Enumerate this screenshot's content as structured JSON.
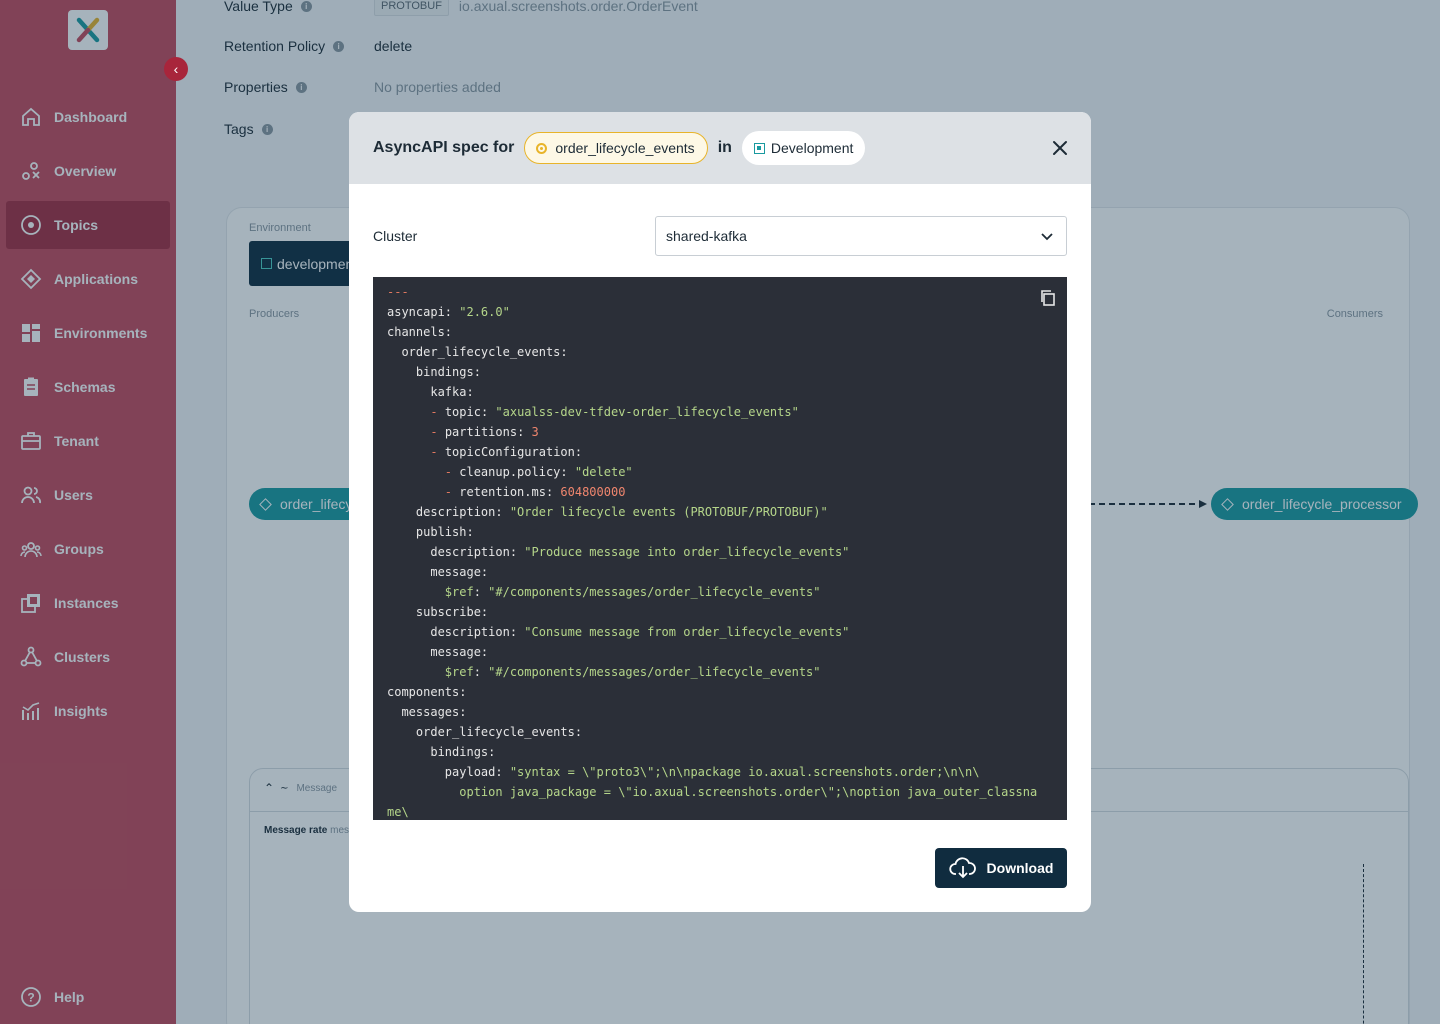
{
  "sidebar": {
    "items": [
      {
        "label": "Dashboard",
        "icon": "home-icon"
      },
      {
        "label": "Overview",
        "icon": "overview-icon"
      },
      {
        "label": "Topics",
        "icon": "topic-icon",
        "active": true
      },
      {
        "label": "Applications",
        "icon": "application-icon"
      },
      {
        "label": "Environments",
        "icon": "environment-icon"
      },
      {
        "label": "Schemas",
        "icon": "schema-icon"
      },
      {
        "label": "Tenant",
        "icon": "tenant-icon"
      },
      {
        "label": "Users",
        "icon": "users-icon"
      },
      {
        "label": "Groups",
        "icon": "groups-icon"
      },
      {
        "label": "Instances",
        "icon": "instances-icon"
      },
      {
        "label": "Clusters",
        "icon": "clusters-icon"
      },
      {
        "label": "Insights",
        "icon": "insights-icon"
      }
    ],
    "help": "Help"
  },
  "topic_meta": {
    "value_type_label": "Value Type",
    "value_type_chip": "PROTOBUF",
    "value_type_value": "io.axual.screenshots.order.OrderEvent",
    "retention_label": "Retention Policy",
    "retention_value": "delete",
    "properties_label": "Properties",
    "properties_value": "No properties added",
    "tags_label": "Tags"
  },
  "graph": {
    "environment_label": "Environment",
    "environment_button": "developmen",
    "producers_label": "Producers",
    "consumers_label": "Consumers",
    "producer_node": "order_lifecy",
    "consumer_node": "order_lifecycle_processor",
    "message_label": "Message",
    "message_rate_label": "Message rate",
    "message_rate_unit": "mess"
  },
  "modal": {
    "title": "AsyncAPI spec for",
    "topic": "order_lifecycle_events",
    "in_word": "in",
    "environment": "Development",
    "cluster_label": "Cluster",
    "cluster_value": "shared-kafka",
    "download_label": "Download"
  },
  "colors": {
    "sidebar": "#c34a5c",
    "sidebar_active": "#a42d41",
    "primary_dark": "#102c3f",
    "teal": "#1a9aa0",
    "topic_yellow": "#e8b42a",
    "code_bg": "#2b2f38"
  }
}
